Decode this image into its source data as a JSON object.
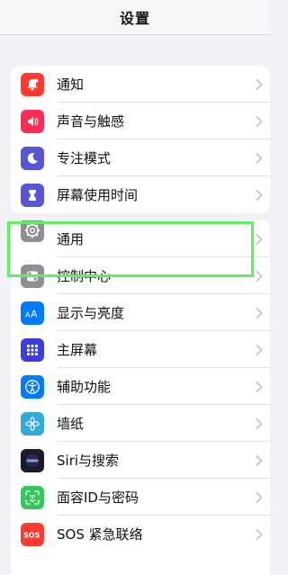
{
  "header": {
    "title": "设置"
  },
  "colors": {
    "notifications": "#ff3b30",
    "sounds": "#ff2d55",
    "focus": "#5856d6",
    "screen_time": "#5856d6",
    "general": "#8e8e93",
    "control_center": "#8e8e93",
    "display": "#007aff",
    "home_screen": "#4b4bd8",
    "accessibility": "#007aff",
    "wallpaper": "#34aadc",
    "siri": "#1a1a2a",
    "faceid": "#34c759",
    "sos": "#ff3b30",
    "highlight": "#5ef05e"
  },
  "group1": {
    "items": [
      {
        "label": "通知",
        "icon": "bell-icon"
      },
      {
        "label": "声音与触感",
        "icon": "speaker-icon"
      },
      {
        "label": "专注模式",
        "icon": "moon-icon"
      },
      {
        "label": "屏幕使用时间",
        "icon": "hourglass-icon"
      }
    ]
  },
  "group2": {
    "items": [
      {
        "label": "通用",
        "icon": "gear-icon"
      },
      {
        "label": "控制中心",
        "icon": "toggles-icon"
      },
      {
        "label": "显示与亮度",
        "icon": "text-size-icon"
      },
      {
        "label": "主屏幕",
        "icon": "app-grid-icon"
      },
      {
        "label": "辅助功能",
        "icon": "accessibility-icon"
      },
      {
        "label": "墙纸",
        "icon": "flower-icon"
      },
      {
        "label": "Siri与搜索",
        "icon": "siri-icon"
      },
      {
        "label": "面容ID与密码",
        "icon": "face-id-icon"
      },
      {
        "label": "SOS 紧急联络",
        "icon": "sos-icon"
      }
    ]
  }
}
